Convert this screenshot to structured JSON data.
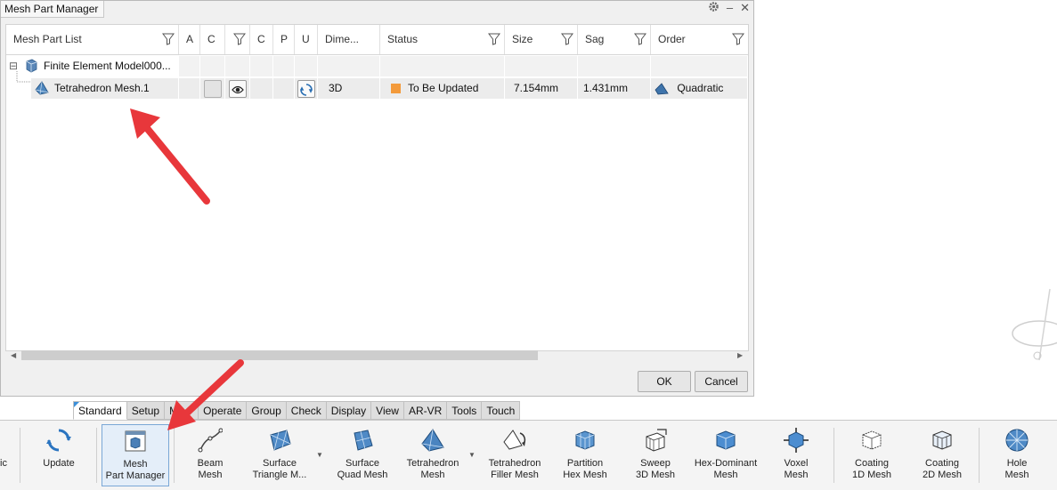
{
  "dialog": {
    "title": "Mesh Part Manager",
    "controls": {
      "settings_icon": "gear-icon",
      "minimize": "–",
      "close": "✕"
    },
    "columns": [
      "Mesh Part List",
      "A",
      "C",
      "C",
      "P",
      "U",
      "Dime...",
      "Status",
      "Size",
      "Sag",
      "Order"
    ],
    "tree": {
      "root": {
        "expander": "⊟",
        "label": "Finite Element Model000..."
      },
      "child": {
        "label": "Tetrahedron Mesh.1",
        "dimension": "3D",
        "status": "To Be Updated",
        "size": "7.154mm",
        "sag": "1.431mm",
        "order": "Quadratic"
      }
    },
    "buttons": {
      "ok": "OK",
      "cancel": "Cancel"
    }
  },
  "tabs": [
    "Standard",
    "Setup",
    "Mesh",
    "Operate",
    "Group",
    "Check",
    "Display",
    "View",
    "AR-VR",
    "Tools",
    "Touch"
  ],
  "tabs_visible": [
    "Standard",
    "Setup",
    "M",
    "Operate",
    "Group",
    "Check",
    "Display",
    "View",
    "AR-VR",
    "Tools",
    "Touch"
  ],
  "toolbar": {
    "left_fragment": "ic",
    "tools": [
      {
        "line1": "Update",
        "line2": ""
      },
      {
        "line1": "Mesh",
        "line2": "Part Manager"
      },
      {
        "line1": "Beam",
        "line2": "Mesh"
      },
      {
        "line1": "Surface",
        "line2": "Triangle M..."
      },
      {
        "line1": "Surface",
        "line2": "Quad Mesh"
      },
      {
        "line1": "Tetrahedron",
        "line2": "Mesh"
      },
      {
        "line1": "Tetrahedron",
        "line2": "Filler Mesh"
      },
      {
        "line1": "Partition",
        "line2": "Hex Mesh"
      },
      {
        "line1": "Sweep",
        "line2": "3D Mesh"
      },
      {
        "line1": "Hex-Dominant",
        "line2": "Mesh"
      },
      {
        "line1": "Voxel",
        "line2": "Mesh"
      },
      {
        "line1": "Coating",
        "line2": "1D Mesh"
      },
      {
        "line1": "Coating",
        "line2": "2D Mesh"
      },
      {
        "line1": "Hole",
        "line2": "Mesh"
      }
    ]
  },
  "colors": {
    "status_orange": "#f39a3b",
    "annotation_red": "#e8373b",
    "tab_accent": "#3b8fd9",
    "selected_tool": "#e4eef9"
  }
}
